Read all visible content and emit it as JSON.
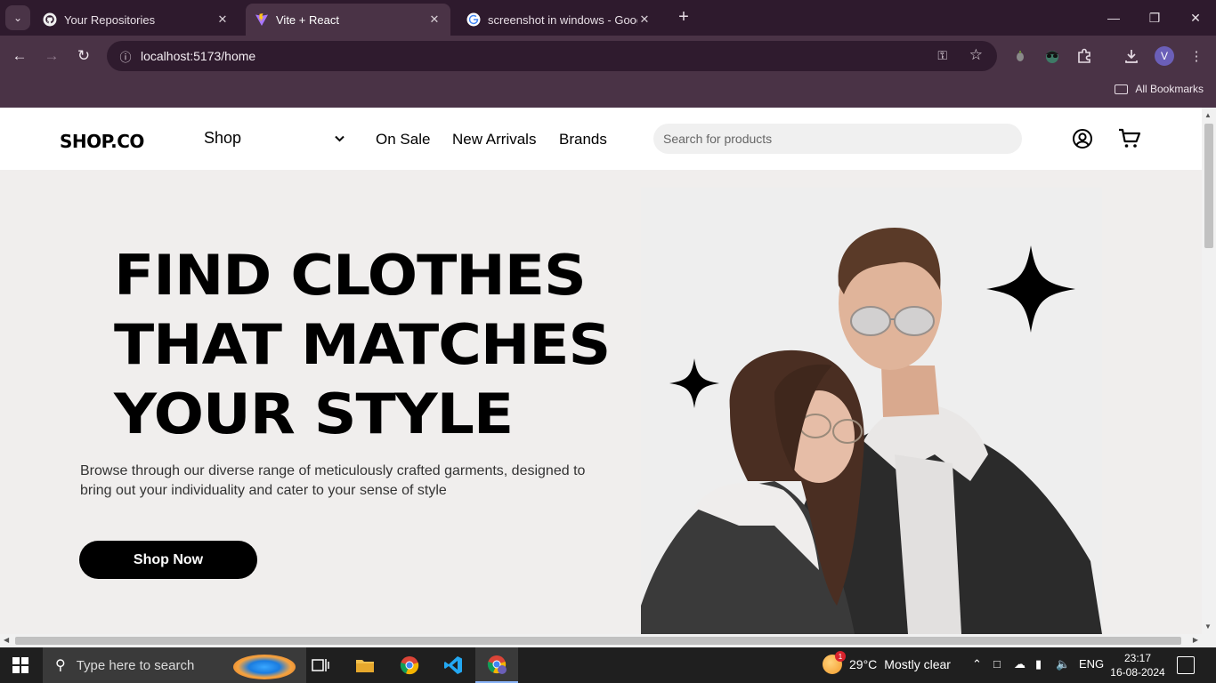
{
  "browser": {
    "tabs": [
      {
        "title": "Your Repositories",
        "icon": "github-icon",
        "active": false
      },
      {
        "title": "Vite + React",
        "icon": "vite-icon",
        "active": true
      },
      {
        "title": "screenshot in windows - Google Search",
        "icon": "google-icon",
        "active": false
      }
    ],
    "new_tab": "+",
    "url": "localhost:5173/home",
    "bookmarks_label": "All Bookmarks",
    "profile_initial": "V"
  },
  "site": {
    "logo": "SHOP.CO",
    "nav": {
      "shop": "Shop",
      "on_sale": "On Sale",
      "new_arrivals": "New Arrivals",
      "brands": "Brands"
    },
    "search_placeholder": "Search for products"
  },
  "hero": {
    "title_lines": [
      "FIND CLOTHES",
      "THAT MATCHES",
      "YOUR STYLE"
    ],
    "description": "Browse through our diverse range of meticulously crafted garments, designed to bring out your individuality and cater to your sense of style",
    "cta": "Shop Now"
  },
  "taskbar": {
    "search_placeholder": "Type here to search",
    "weather_temp": "29°C",
    "weather_desc": "Mostly clear",
    "weather_badge": "1",
    "language": "ENG",
    "time": "23:17",
    "date": "16-08-2024"
  }
}
